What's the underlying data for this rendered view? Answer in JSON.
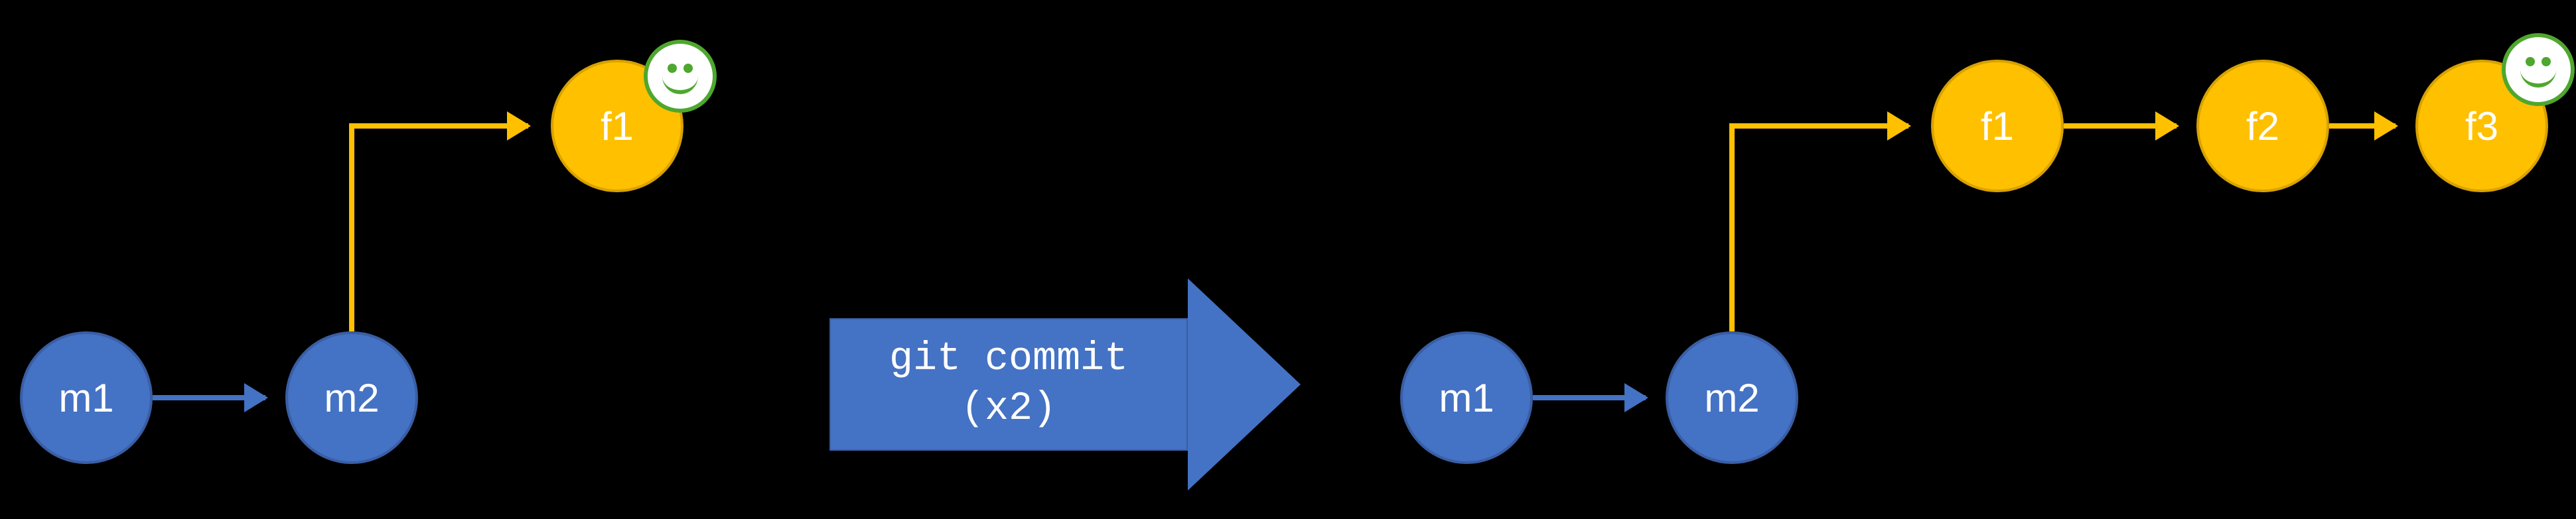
{
  "colors": {
    "background": "#000000",
    "main_branch": "#4472C4",
    "feature_branch": "#FFC000",
    "smiley_outline": "#4EA72E",
    "smiley_fill": "#FFFFFF"
  },
  "left_graph": {
    "main_commits": [
      {
        "id": "m1",
        "label": "m1"
      },
      {
        "id": "m2",
        "label": "m2"
      }
    ],
    "feature_commits": [
      {
        "id": "f1",
        "label": "f1"
      }
    ],
    "edges": [
      {
        "from": "m1",
        "to": "m2",
        "color": "main_branch"
      },
      {
        "from": "m2",
        "to": "f1",
        "color": "feature_branch"
      }
    ],
    "head_on": "f1"
  },
  "action": {
    "command": "git commit",
    "repeat_label": "(x2)",
    "repeat_count": 2
  },
  "right_graph": {
    "main_commits": [
      {
        "id": "m1",
        "label": "m1"
      },
      {
        "id": "m2",
        "label": "m2"
      }
    ],
    "feature_commits": [
      {
        "id": "f1",
        "label": "f1"
      },
      {
        "id": "f2",
        "label": "f2"
      },
      {
        "id": "f3",
        "label": "f3"
      }
    ],
    "edges": [
      {
        "from": "m1",
        "to": "m2",
        "color": "main_branch"
      },
      {
        "from": "m2",
        "to": "f1",
        "color": "feature_branch"
      },
      {
        "from": "f1",
        "to": "f2",
        "color": "feature_branch"
      },
      {
        "from": "f2",
        "to": "f3",
        "color": "feature_branch"
      }
    ],
    "head_on": "f3"
  },
  "chart_data": {
    "type": "diagram",
    "description": "Git commit graph before and after running git commit twice on a feature branch",
    "before": {
      "commits": [
        "m1",
        "m2",
        "f1"
      ],
      "parents": {
        "m2": "m1",
        "f1": "m2"
      },
      "branch_of": {
        "m1": "main",
        "m2": "main",
        "f1": "feature"
      },
      "head": "f1"
    },
    "after": {
      "commits": [
        "m1",
        "m2",
        "f1",
        "f2",
        "f3"
      ],
      "parents": {
        "m2": "m1",
        "f1": "m2",
        "f2": "f1",
        "f3": "f2"
      },
      "branch_of": {
        "m1": "main",
        "m2": "main",
        "f1": "feature",
        "f2": "feature",
        "f3": "feature"
      },
      "head": "f3"
    },
    "operation": "git commit (x2)"
  }
}
